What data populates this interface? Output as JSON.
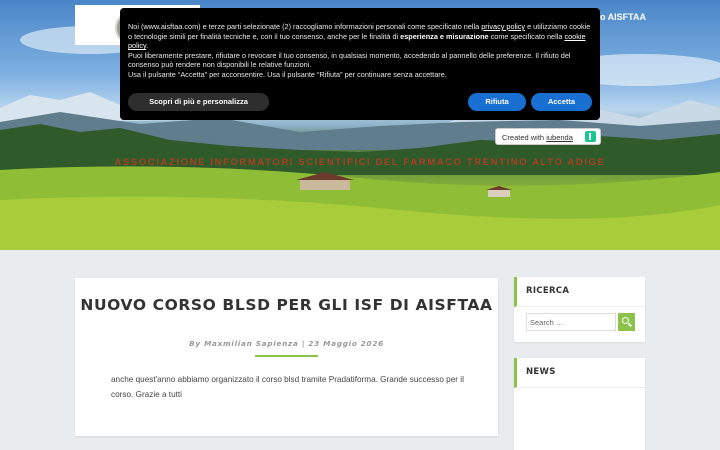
{
  "header": {
    "right_text": "o AISFTAA",
    "tagline": "ASSOCIAZIONE INFORMATORI SCIENTIFICI DEL FARMACO TRENTINO ALTO ADIGE"
  },
  "cookie_banner": {
    "line1_a": "Noi (www.aisftaa.com) e terze parti selezionate (2) raccogliamo informazioni personali come specificato nella ",
    "line1_link": "privacy policy",
    "line1_b": " e utilizziamo cookie o tecnologie simili per finalità tecniche e, con il tuo consenso, anche per le finalità di ",
    "bold1": "esperienza e misurazione",
    "line2_a": " come specificato nella ",
    "line2_link": "cookie policy",
    "line2_b": ".",
    "line3": "Puoi liberamente prestare, rifiutare o revocare il tuo consenso, in qualsiasi momento, accedendo al pannello delle preferenze. Il rifiuto del consenso può rendere non disponibili le relative funzioni.",
    "line4": "Usa il pulsante “Accetta” per acconsentire. Usa il pulsante “Rifiuta” per continuare senza accettare.",
    "more_button": "Scopri di più e personalizza",
    "reject_button": "Rifiuta",
    "accept_button": "Accetta"
  },
  "iubenda": {
    "prefix": "Created with ",
    "brand": "iubenda"
  },
  "post": {
    "title": "NUOVO CORSO BLSD PER GLI ISF DI AISFTAA",
    "meta": "By Maxmilian Sapienza | 23 Maggio 2026",
    "body": "anche quest'anno abbiamo organizzato il corso blsd tramite Pradatiforma. Grande successo per il corso. Grazie a tutti"
  },
  "sidebar": {
    "search_title": "RICERCA",
    "search_placeholder": "Search …",
    "news_title": "NEWS"
  },
  "colors": {
    "accent": "#8bc34a",
    "cookie_button": "#1a6fd3",
    "tagline": "#c23b22"
  }
}
